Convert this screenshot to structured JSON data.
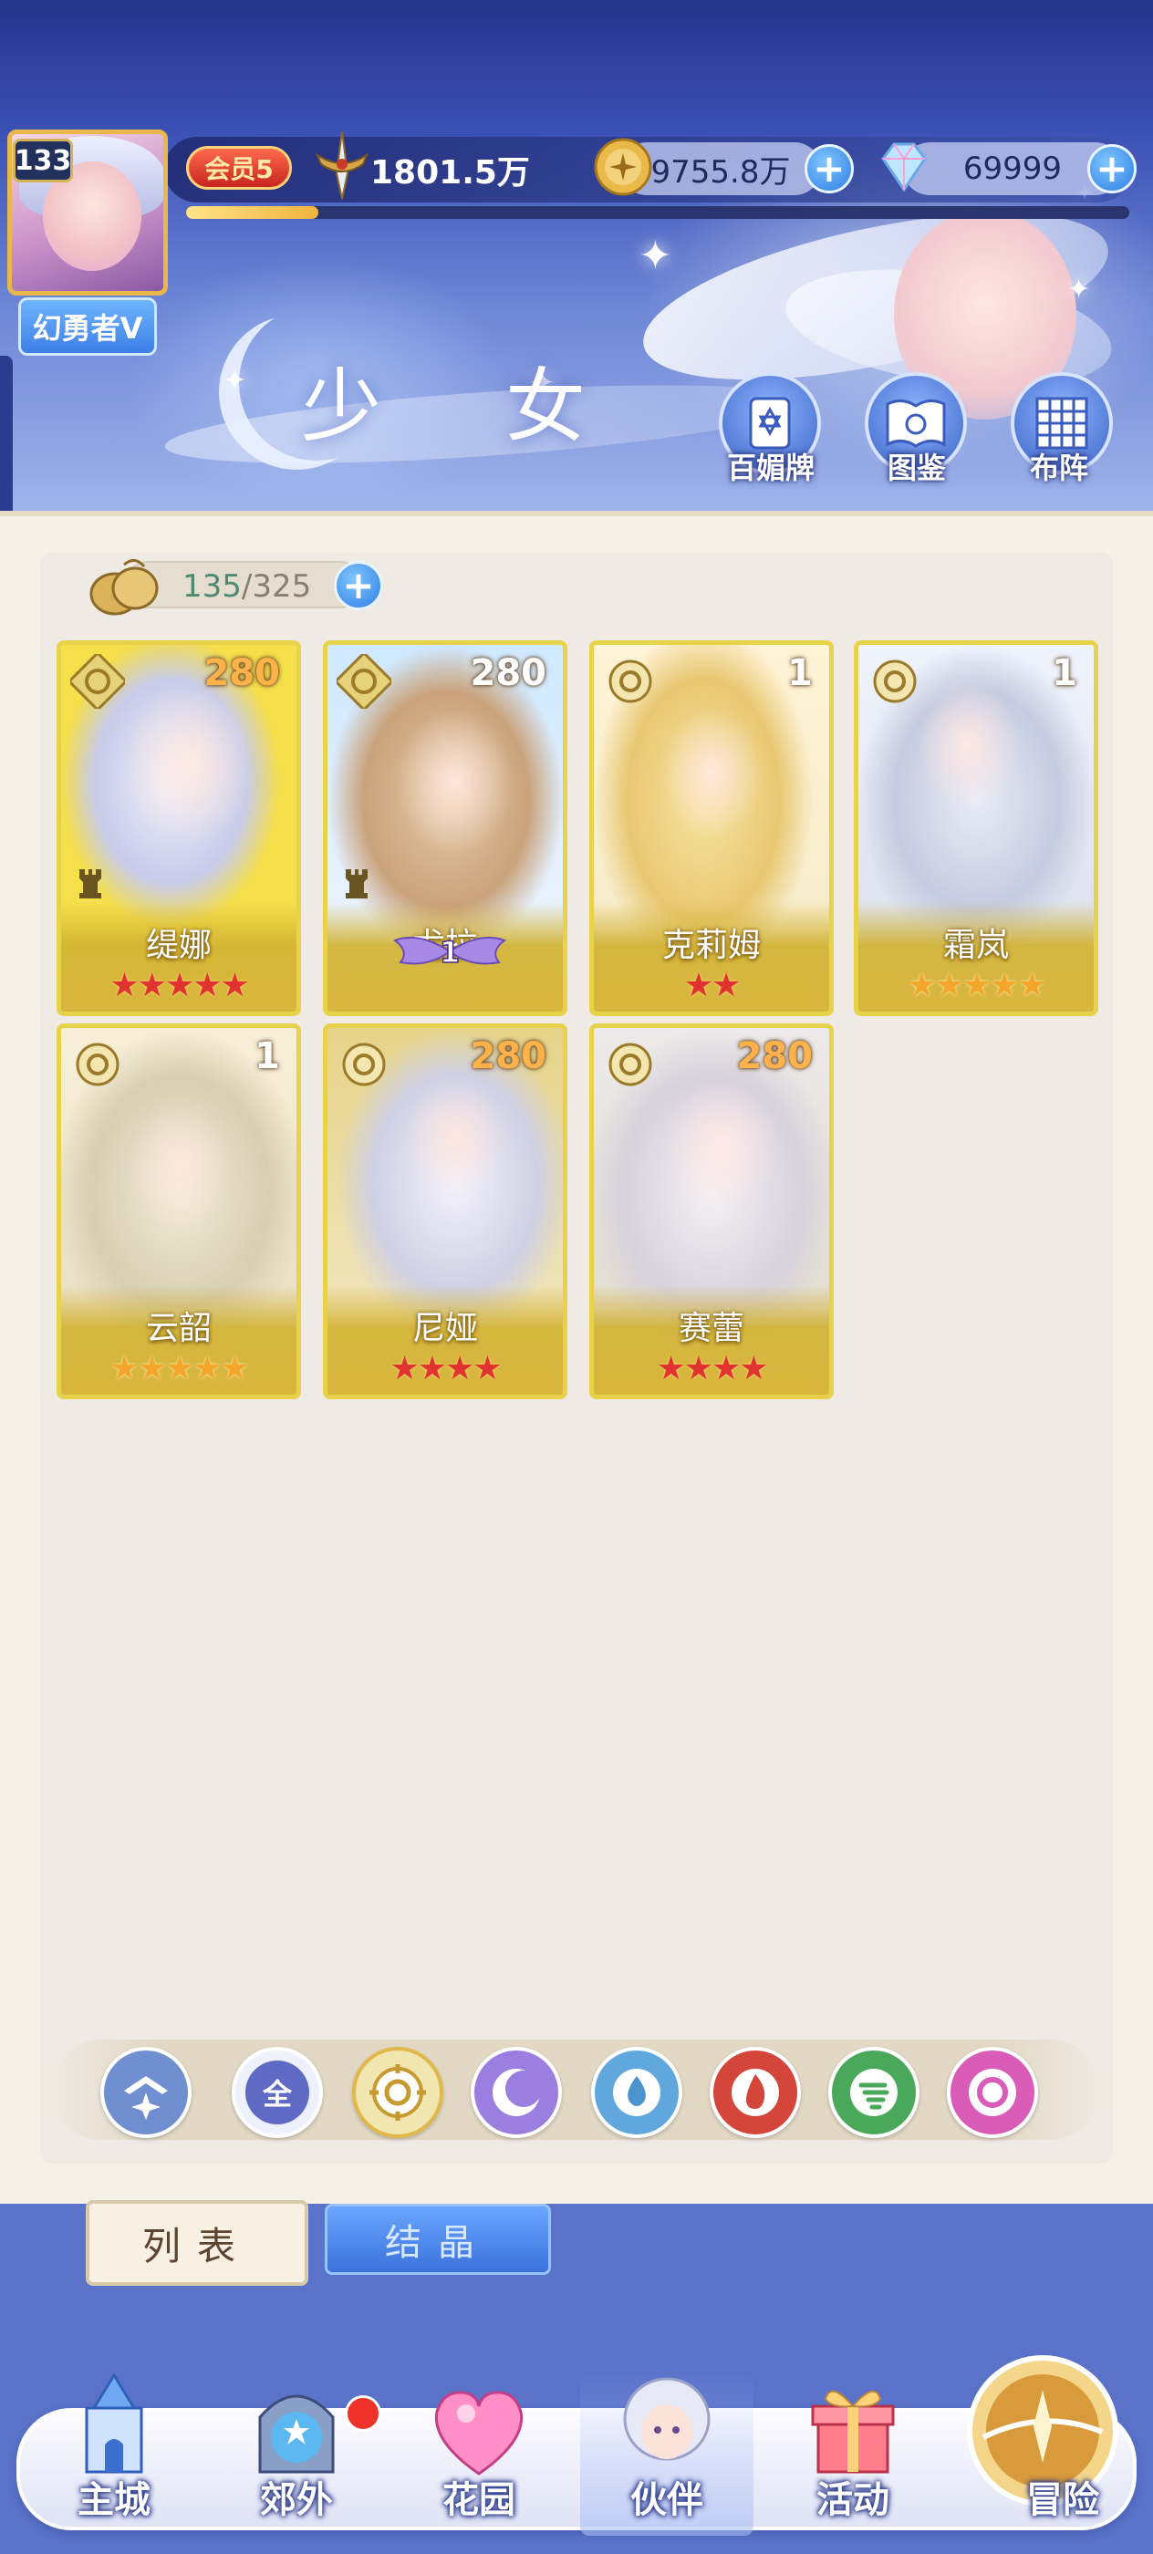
{
  "header": {
    "title": "少 女",
    "player": {
      "level": "133",
      "name": "幻勇者V",
      "vip": "会员5",
      "power": "1801.5万"
    },
    "gold": "9755.8万",
    "diamond": "69999",
    "exp_progress": 0.14,
    "quick_buttons": [
      {
        "label": "百媚牌",
        "icon": "card-icon"
      },
      {
        "label": "图鉴",
        "icon": "book-icon"
      },
      {
        "label": "布阵",
        "icon": "formation-grid-icon"
      }
    ]
  },
  "capacity": {
    "current": "135",
    "total": "/325"
  },
  "cards": [
    {
      "name": "缇娜",
      "level": "280",
      "stars": 5,
      "star_color": "red",
      "element": "sun"
    },
    {
      "name": "尤拉",
      "level": "280",
      "stars": 0,
      "star_color": "red",
      "element": "sun",
      "badge": "1"
    },
    {
      "name": "克莉姆",
      "level": "1",
      "stars": 2,
      "star_color": "red",
      "element": "sun"
    },
    {
      "name": "霜岚",
      "level": "1",
      "stars": 5,
      "star_color": "gold",
      "element": "sun"
    },
    {
      "name": "云韶",
      "level": "1",
      "stars": 5,
      "star_color": "gold",
      "element": "sun"
    },
    {
      "name": "尼娅",
      "level": "280",
      "stars": 4,
      "star_color": "red",
      "element": "sun"
    },
    {
      "name": "赛蕾",
      "level": "280",
      "stars": 4,
      "star_color": "red",
      "element": "sun"
    }
  ],
  "filters": [
    {
      "label": "",
      "icon": "wing-sparkle-icon"
    },
    {
      "label": "全",
      "icon": "all-icon"
    },
    {
      "label": "",
      "icon": "sun-gear-icon"
    },
    {
      "label": "",
      "icon": "moon-icon"
    },
    {
      "label": "",
      "icon": "water-drop-icon"
    },
    {
      "label": "",
      "icon": "fire-icon"
    },
    {
      "label": "",
      "icon": "wind-icon"
    },
    {
      "label": "",
      "icon": "pink-orb-icon"
    }
  ],
  "tabs": {
    "list": "列表",
    "crystal": "结晶"
  },
  "nav": [
    {
      "label": "主城",
      "icon": "castle-icon"
    },
    {
      "label": "郊外",
      "icon": "portal-icon"
    },
    {
      "label": "花园",
      "icon": "heart-garden-icon"
    },
    {
      "label": "伙伴",
      "icon": "partner-avatar-icon"
    },
    {
      "label": "活动",
      "icon": "gift-icon"
    },
    {
      "label": "冒险",
      "icon": "adventure-orb-icon"
    }
  ]
}
